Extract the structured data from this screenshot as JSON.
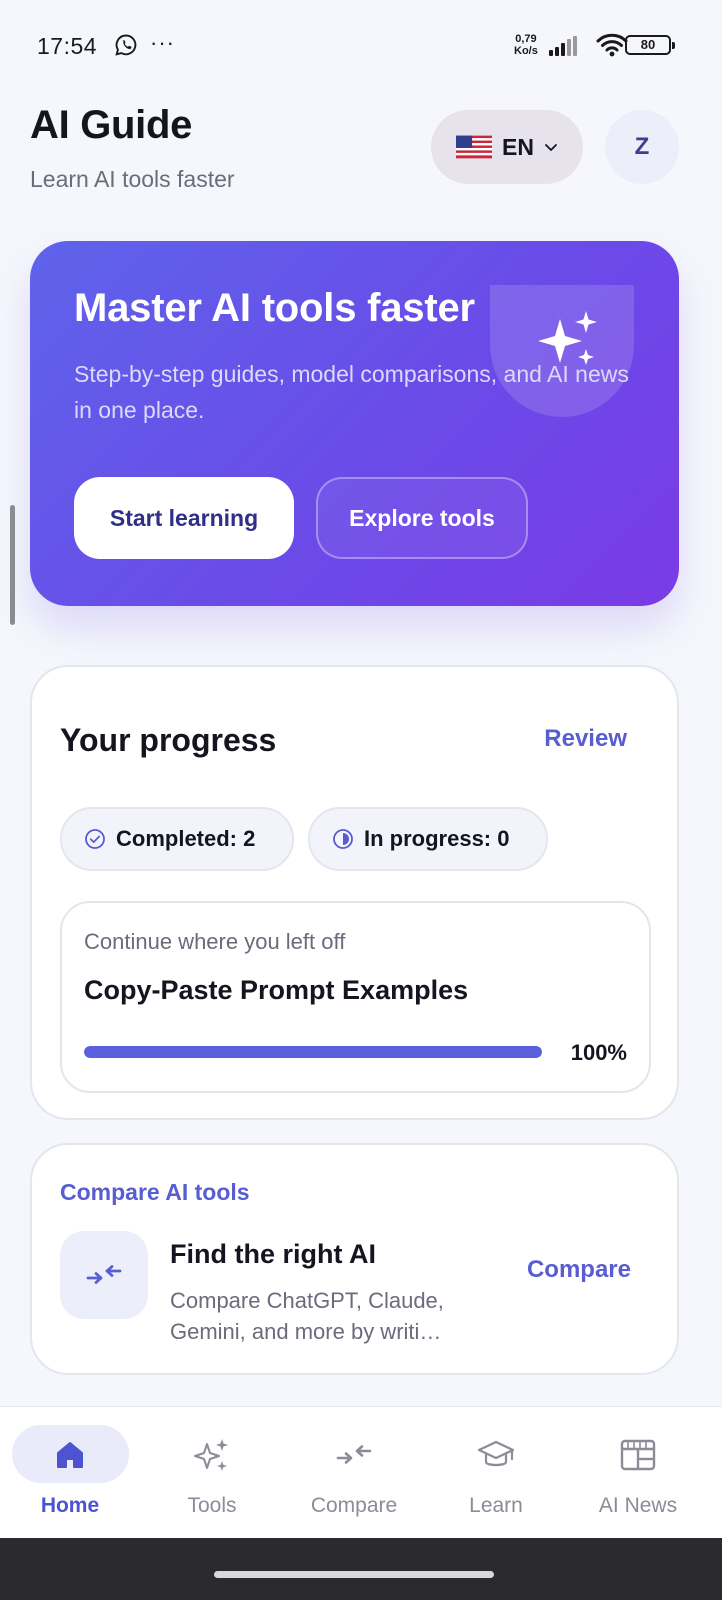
{
  "status_bar": {
    "time": "17:54",
    "more": "···",
    "net_speed_value": "0,79",
    "net_speed_unit": "Ko/s",
    "battery": "80",
    "icons": [
      "whatsapp-icon",
      "signal-icon",
      "wifi-icon",
      "battery-icon"
    ]
  },
  "header": {
    "title": "AI Guide",
    "subtitle": "Learn AI tools faster",
    "language": {
      "flag": "us-flag-icon",
      "code": "EN"
    },
    "avatar_initial": "Z"
  },
  "hero": {
    "title": "Master AI tools faster",
    "description": "Step-by-step guides, model comparisons, and AI news in one place.",
    "primary_button": "Start learning",
    "secondary_button": "Explore tools",
    "icon": "sparkles-icon"
  },
  "progress": {
    "title": "Your progress",
    "review_label": "Review",
    "completed_label": "Completed: 2",
    "in_progress_label": "In progress: 0",
    "continue": {
      "label": "Continue where you left off",
      "title": "Copy-Paste Prompt Examples",
      "percent_label": "100%",
      "percent_value": 100
    }
  },
  "compare": {
    "eyebrow": "Compare AI tools",
    "title": "Find the right AI",
    "description": "Compare ChatGPT, Claude, Gemini, and more by writi…",
    "link_label": "Compare"
  },
  "bottom_nav": {
    "items": [
      {
        "label": "Home",
        "icon": "home-icon",
        "active": true
      },
      {
        "label": "Tools",
        "icon": "sparkles-icon",
        "active": false
      },
      {
        "label": "Compare",
        "icon": "compare-arrows-icon",
        "active": false
      },
      {
        "label": "Learn",
        "icon": "graduation-cap-icon",
        "active": false
      },
      {
        "label": "AI News",
        "icon": "newspaper-icon",
        "active": false
      }
    ]
  },
  "colors": {
    "accent": "#585dd1",
    "hero_gradient_start": "#5e63ea",
    "hero_gradient_end": "#7a3be6",
    "background": "#f6f7fc"
  }
}
